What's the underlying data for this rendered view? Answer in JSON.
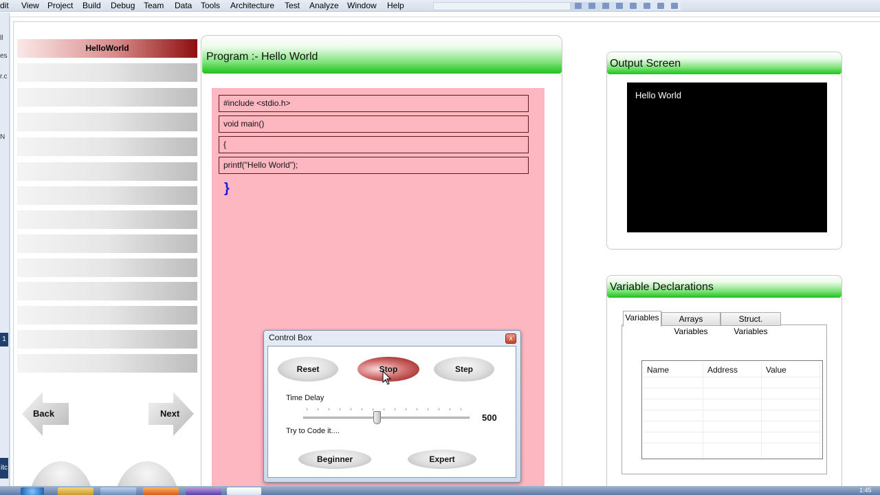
{
  "menu": {
    "items": [
      "dit",
      "View",
      "Project",
      "Build",
      "Debug",
      "Team",
      "Data",
      "Tools",
      "Architecture",
      "Test",
      "Analyze",
      "Window",
      "Help"
    ]
  },
  "vs_edge": {
    "fragments": [
      "ll",
      "es",
      "r.c",
      "N",
      "1",
      "itc"
    ]
  },
  "sidebar": {
    "active_item": "HelloWorld",
    "back_label": "Back",
    "next_label": "Next"
  },
  "program": {
    "title": "Program :- Hello World",
    "lines": [
      "#include <stdio.h>",
      "void main()",
      "{",
      "printf(\"Hello World\");"
    ],
    "closing_brace": "}"
  },
  "output": {
    "title": "Output Screen",
    "text": "Hello World"
  },
  "variables": {
    "title": "Variable Declarations",
    "tabs": [
      "Variables",
      "Arrays Variables",
      "Struct. Variables"
    ],
    "active_tab": "Variables",
    "columns": [
      "Name",
      "Address",
      "Value"
    ]
  },
  "control_box": {
    "title": "Control Box",
    "close_glyph": "x",
    "buttons": {
      "reset": "Reset",
      "stop": "Stop",
      "step": "Step"
    },
    "time_delay_label": "Time Delay",
    "time_delay_value": "500",
    "try_label": "Try to Code it....",
    "beginner_label": "Beginner",
    "expert_label": "Expert"
  },
  "taskbar": {
    "clock": "1:45"
  },
  "colors": {
    "code_bg": "#fdb7c0",
    "header_green": "#1dc21a",
    "active_red": "#8e0e0e",
    "brace_blue": "#1a1adc"
  }
}
